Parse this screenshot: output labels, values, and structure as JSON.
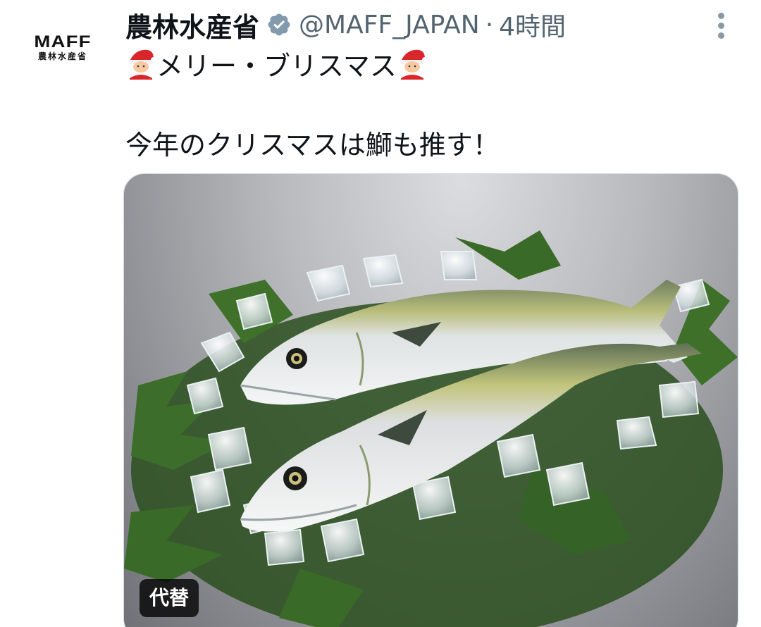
{
  "author": {
    "display_name": "農林水産省",
    "handle": "@MAFF_JAPAN",
    "separator": "·",
    "time": "4時間",
    "avatar_logo": "MAFF",
    "avatar_sub": "農林水産省",
    "verified_icon": "verified-badge-icon",
    "verified_color": "#829aab"
  },
  "more_icon": "more-vertical-icon",
  "tweet": {
    "line1": "メリー・ブリスマス",
    "line1_emoji": "santa-emoji",
    "line2": "今年のクリスマスは鰤も推す！"
  },
  "media": {
    "image": "photo of two yellowtail fish on ice and cedar leaves",
    "alt_label": "代替"
  }
}
